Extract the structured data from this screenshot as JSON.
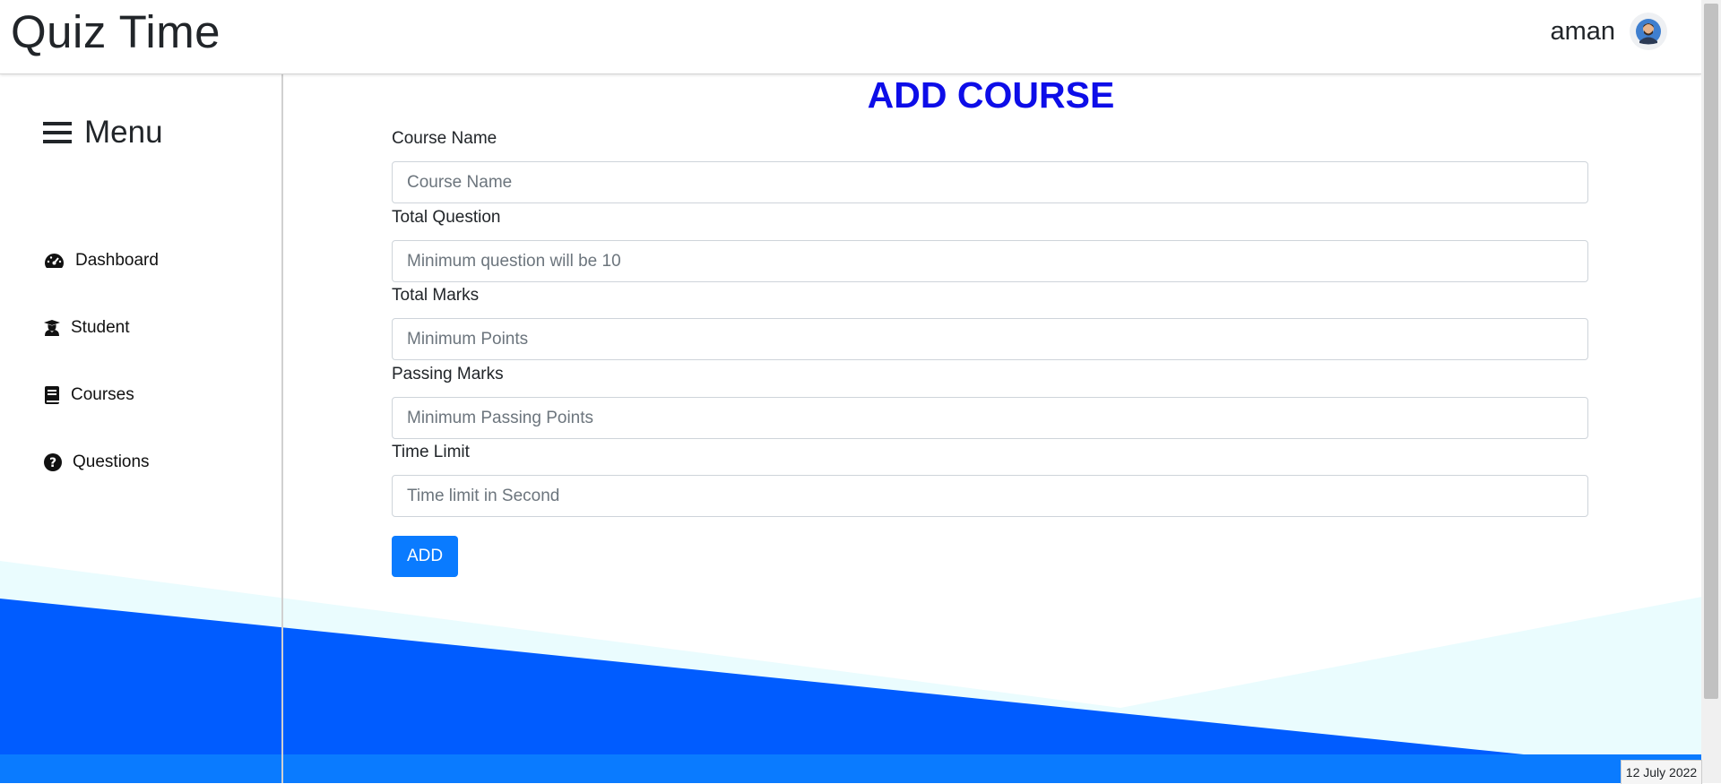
{
  "header": {
    "brand": "Quiz Time",
    "username": "aman"
  },
  "sidebar": {
    "menu_label": "Menu",
    "items": [
      {
        "label": "Dashboard",
        "icon": "dashboard-icon"
      },
      {
        "label": "Student",
        "icon": "student-icon"
      },
      {
        "label": "Courses",
        "icon": "book-icon"
      },
      {
        "label": "Questions",
        "icon": "question-circle-icon"
      }
    ]
  },
  "form": {
    "title": "ADD COURSE",
    "fields": [
      {
        "label": "Course Name",
        "placeholder": "Course Name"
      },
      {
        "label": "Total Question",
        "placeholder": "Minimum question will be 10"
      },
      {
        "label": "Total Marks",
        "placeholder": "Minimum Points"
      },
      {
        "label": "Passing Marks",
        "placeholder": "Minimum Passing Points"
      },
      {
        "label": "Time Limit",
        "placeholder": "Time limit in Second"
      }
    ],
    "submit_label": "ADD"
  },
  "status": {
    "date": "12 July 2022"
  },
  "colors": {
    "primary": "#0a7bff",
    "title": "#0d0de8",
    "wave_dark": "#005cff",
    "wave_light": "#eafcfe"
  }
}
